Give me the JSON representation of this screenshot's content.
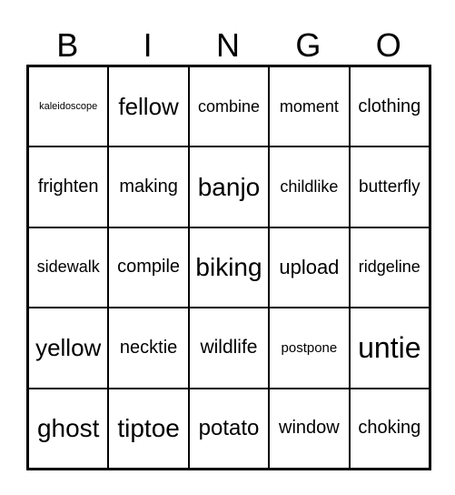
{
  "header": [
    "B",
    "I",
    "N",
    "G",
    "O"
  ],
  "cells": [
    [
      "kaleidoscope",
      "fellow",
      "combine",
      "moment",
      "clothing"
    ],
    [
      "frighten",
      "making",
      "banjo",
      "childlike",
      "butterfly"
    ],
    [
      "sidewalk",
      "compile",
      "biking",
      "upload",
      "ridgeline"
    ],
    [
      "yellow",
      "necktie",
      "wildlife",
      "postpone",
      "untie"
    ],
    [
      "ghost",
      "tiptoe",
      "potato",
      "window",
      "choking"
    ]
  ]
}
